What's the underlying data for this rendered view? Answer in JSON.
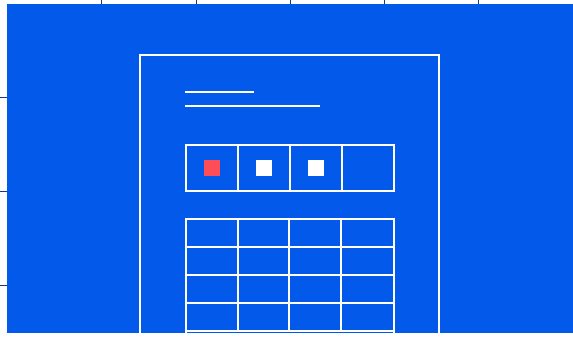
{
  "colors": {
    "background": "#0359ea",
    "outline": "#ffffff",
    "accent": "#ff4d57",
    "marker": "#ffffff"
  },
  "row": {
    "cells": [
      {
        "marker": "accent"
      },
      {
        "marker": "white"
      },
      {
        "marker": "white"
      },
      {
        "marker": "none"
      }
    ]
  },
  "grid": {
    "columns": 4,
    "rows": 4
  }
}
